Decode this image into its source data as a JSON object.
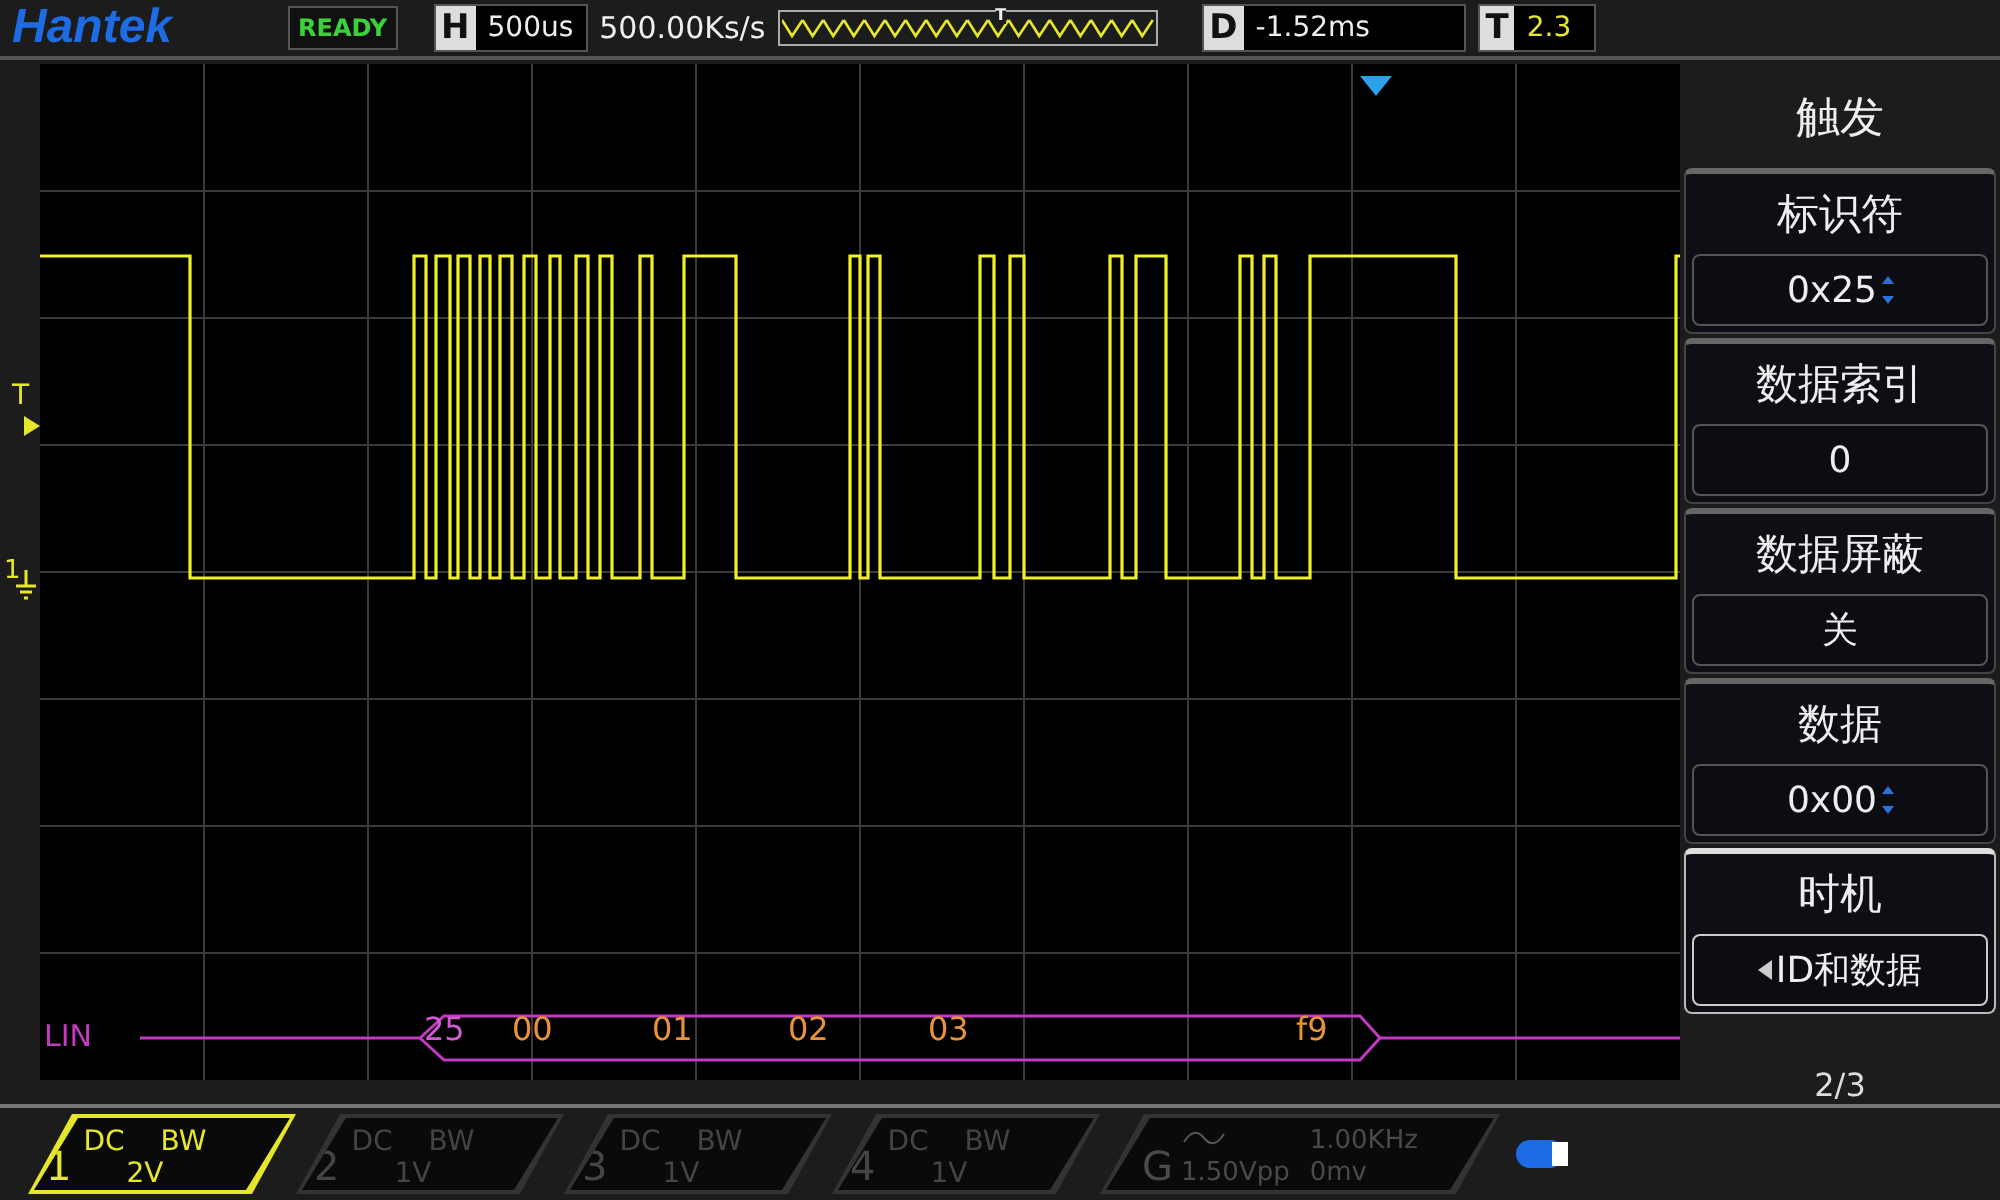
{
  "top_bar": {
    "logo": "Hantek",
    "status": "READY",
    "horizontal": {
      "label": "H",
      "value": "500us"
    },
    "sample_rate": "500.00Ks/s",
    "trigger_position_mark": "T",
    "delay": {
      "label": "D",
      "value": "-1.52ms"
    },
    "trigger_level": {
      "label": "T",
      "value": "2.3"
    }
  },
  "scope": {
    "trigger_marker": "T",
    "channel_marker": "1",
    "decode": {
      "label": "LIN",
      "bytes": [
        {
          "text": "25",
          "kind": "id"
        },
        {
          "text": "00",
          "kind": "data"
        },
        {
          "text": "01",
          "kind": "data"
        },
        {
          "text": "02",
          "kind": "data"
        },
        {
          "text": "03",
          "kind": "data"
        },
        {
          "text": "f9",
          "kind": "checksum"
        }
      ]
    }
  },
  "menu": {
    "title": "触发",
    "items": [
      {
        "label": "标识符",
        "value": "0x25",
        "adjustable": true,
        "selected": false
      },
      {
        "label": "数据索引",
        "value": "0",
        "adjustable": false,
        "selected": false
      },
      {
        "label": "数据屏蔽",
        "value": "关",
        "adjustable": false,
        "selected": false
      },
      {
        "label": "数据",
        "value": "0x00",
        "adjustable": true,
        "selected": false
      },
      {
        "label": "时机",
        "value": "ID和数据",
        "adjustable": false,
        "selected": true
      }
    ],
    "page": "2/3"
  },
  "channels": [
    {
      "number": "1",
      "coupling": "DC",
      "bandwidth": "BW",
      "scale": "2V",
      "selected": true
    },
    {
      "number": "2",
      "coupling": "DC",
      "bandwidth": "BW",
      "scale": "1V",
      "selected": false
    },
    {
      "number": "3",
      "coupling": "DC",
      "bandwidth": "BW",
      "scale": "1V",
      "selected": false
    },
    {
      "number": "4",
      "coupling": "DC",
      "bandwidth": "BW",
      "scale": "1V",
      "selected": false
    }
  ],
  "generator": {
    "label": "G",
    "frequency": "1.00KHz",
    "amplitude": "1.50Vpp",
    "offset": "0mv"
  }
}
